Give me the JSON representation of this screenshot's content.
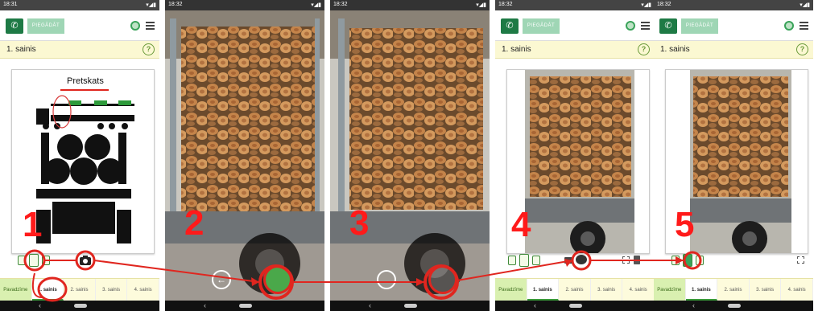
{
  "screens": [
    {
      "time": "18:31",
      "deliver": "PIEGĀDĀT",
      "title": "1. sainis",
      "diagram_label": "Pretskats",
      "step": "1",
      "tabs": [
        "Pavadzīme",
        "1. sainis",
        "2. sainis",
        "3. sainis",
        "4. sainis"
      ]
    },
    {
      "time": "18:32",
      "step": "2"
    },
    {
      "time": "18:32",
      "step": "3"
    },
    {
      "time": "18:32",
      "deliver": "PIEGĀDĀT",
      "title": "1. sainis",
      "step": "4",
      "tabs": [
        "Pavadzīme",
        "1. sainis",
        "2. sainis",
        "3. sainis",
        "4. sainis"
      ]
    },
    {
      "time": "18:32",
      "deliver": "PIEGĀDĀT",
      "title": "1. sainis",
      "step": "5",
      "tabs": [
        "Pavadzīme",
        "1. sainis",
        "2. sainis",
        "3. sainis",
        "4. sainis"
      ]
    }
  ],
  "help_symbol": "?",
  "colors": {
    "accent": "#1e7a45",
    "highlight": "#ff1a1a",
    "tab_bg": "#fdfbdc",
    "title_bg": "#fbf8d2"
  },
  "icons": [
    "phone-icon",
    "cloud-icon",
    "menu-icon",
    "help-icon",
    "camera-icon",
    "back-arrow-icon",
    "shutter-icon",
    "upload-icon",
    "fullscreen-icon",
    "delete-icon"
  ]
}
